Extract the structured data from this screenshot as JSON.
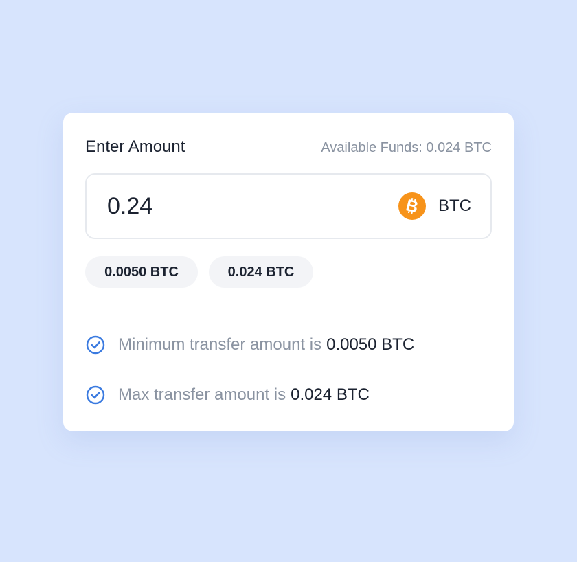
{
  "card": {
    "title": "Enter Amount",
    "available_funds": "Available Funds: 0.024 BTC"
  },
  "amount_field": {
    "value": "0.24",
    "currency": "BTC",
    "currency_icon": "bitcoin-icon",
    "icon_color": "#f7931a"
  },
  "quick_amounts": [
    {
      "label": "0.0050 BTC"
    },
    {
      "label": "0.024 BTC"
    }
  ],
  "rules": [
    {
      "text": "Minimum transfer amount is",
      "value": "0.0050 BTC",
      "icon": "check-circle-icon"
    },
    {
      "text": "Max transfer amount is",
      "value": "0.024 BTC",
      "icon": "check-circle-icon"
    }
  ],
  "colors": {
    "background": "#d7e4fd",
    "accent": "#3b7be0",
    "text_primary": "#1b2230",
    "text_muted": "#8a93a1"
  }
}
